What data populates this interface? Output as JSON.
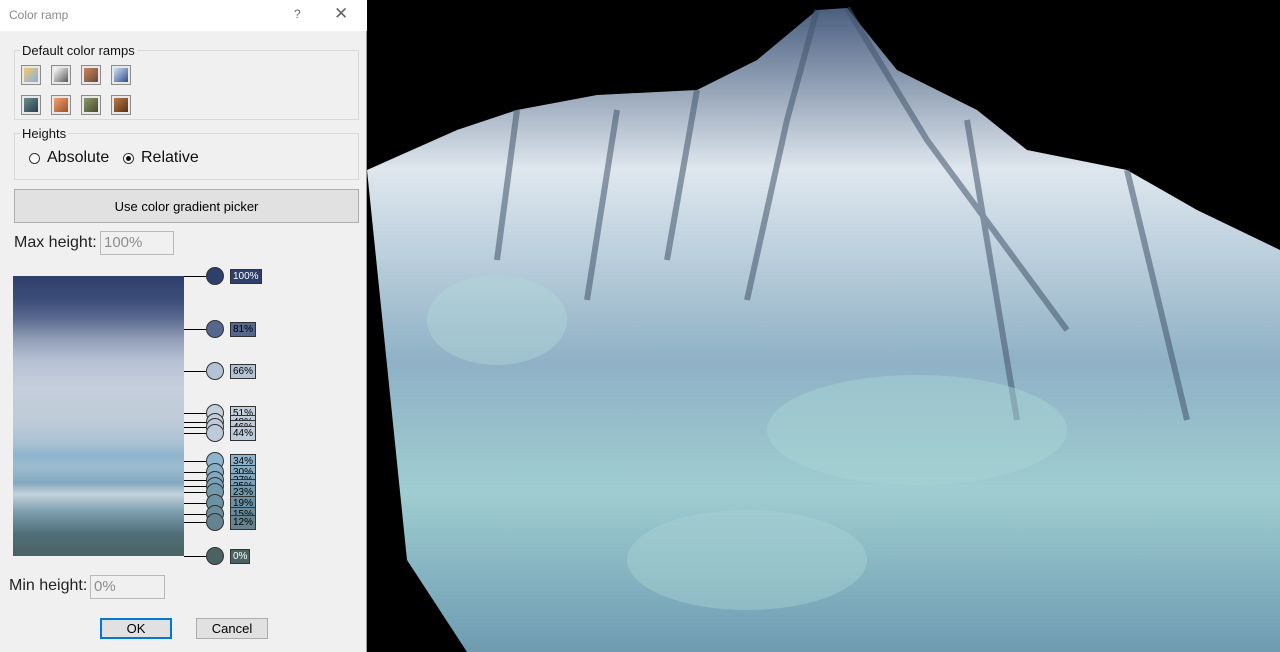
{
  "dialog": {
    "title": "Color ramp",
    "help_glyph": "?",
    "close_glyph": "✕",
    "default_ramps_label": "Default color ramps",
    "ramps": [
      {
        "name": "rainbow",
        "c1": "#f7c86a",
        "c2": "#7fb0e6"
      },
      {
        "name": "grayscale",
        "c1": "#ffffff",
        "c2": "#5a5a5a"
      },
      {
        "name": "copper",
        "c1": "#c8845a",
        "c2": "#6c4a3a"
      },
      {
        "name": "steel-blue",
        "c1": "#cfe0f3",
        "c2": "#2f4f8a"
      },
      {
        "name": "teal-slate",
        "c1": "#6a8f8f",
        "c2": "#2a3d4a"
      },
      {
        "name": "orange",
        "c1": "#f0a070",
        "c2": "#a0502a"
      },
      {
        "name": "olive",
        "c1": "#8a9a6a",
        "c2": "#4a4a2a"
      },
      {
        "name": "brown",
        "c1": "#b87a4a",
        "c2": "#5a3010"
      }
    ],
    "heights_label": "Heights",
    "absolute_label": "Absolute",
    "relative_label": "Relative",
    "selected_mode": "relative",
    "gradient_picker_label": "Use color gradient picker",
    "max_height_label": "Max height:",
    "max_height_value": "100%",
    "min_height_label": "Min height:",
    "min_height_value": "0%",
    "ok_label": "OK",
    "cancel_label": "Cancel",
    "stops": [
      {
        "label": "100%",
        "color": "#2f3f6b",
        "dark": true
      },
      {
        "label": "81%",
        "color": "#56678e",
        "dark": false
      },
      {
        "label": "66%",
        "color": "#b4c2d4",
        "dark": false
      },
      {
        "label": "51%",
        "color": "#c4cfdc",
        "dark": false
      },
      {
        "label": "48%",
        "color": "#c2cddb",
        "dark": false
      },
      {
        "label": "46%",
        "color": "#bfcbd9",
        "dark": false
      },
      {
        "label": "44%",
        "color": "#bdcad9",
        "dark": false
      },
      {
        "label": "34%",
        "color": "#8eb4cd",
        "dark": false
      },
      {
        "label": "30%",
        "color": "#89afc6",
        "dark": false
      },
      {
        "label": "27%",
        "color": "#82a8bf",
        "dark": false
      },
      {
        "label": "25%",
        "color": "#7a9fb6",
        "dark": false
      },
      {
        "label": "23%",
        "color": "#7399ad",
        "dark": false
      },
      {
        "label": "19%",
        "color": "#6b91a4",
        "dark": false
      },
      {
        "label": "15%",
        "color": "#6a8c9c",
        "dark": false
      },
      {
        "label": "12%",
        "color": "#65848f",
        "dark": false
      },
      {
        "label": "0%",
        "color": "#4a6262",
        "dark": true
      }
    ]
  },
  "viewport": {
    "background": "#000000",
    "terrain_colors": [
      "#dfe7ee",
      "#8fb1c6",
      "#9fcdd0",
      "#41546a",
      "#23303f"
    ]
  }
}
